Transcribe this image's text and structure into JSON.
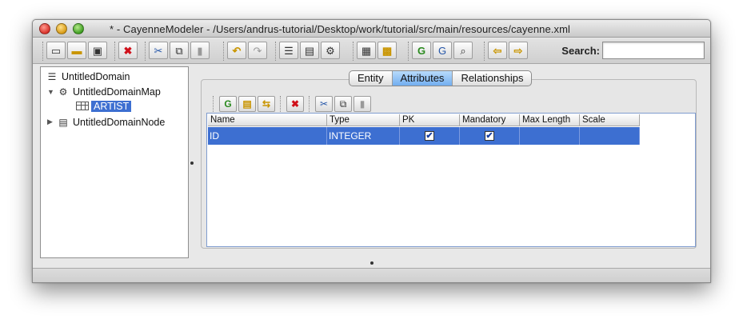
{
  "window": {
    "title": "* - CayenneModeler - /Users/andrus-tutorial/Desktop/work/tutorial/src/main/resources/cayenne.xml"
  },
  "toolbar": {
    "groups": [
      [
        {
          "name": "new-project-icon",
          "glyph": "▭"
        },
        {
          "name": "open-project-icon",
          "glyph": "📂"
        },
        {
          "name": "save-icon",
          "glyph": "▣"
        }
      ],
      [
        {
          "name": "remove-icon",
          "glyph": "✖"
        }
      ],
      [
        {
          "name": "cut-icon",
          "glyph": "✂"
        },
        {
          "name": "copy-icon",
          "glyph": "⧉"
        },
        {
          "name": "paste-icon",
          "glyph": "▮"
        }
      ],
      [
        {
          "name": "undo-icon",
          "glyph": "↶"
        },
        {
          "name": "redo-icon",
          "glyph": "↷"
        }
      ],
      [
        {
          "name": "create-domain-icon",
          "glyph": "☰"
        },
        {
          "name": "create-node-icon",
          "glyph": "▤"
        },
        {
          "name": "create-datamap-icon",
          "glyph": "⚙"
        }
      ],
      [
        {
          "name": "create-entity-icon",
          "glyph": "▦"
        },
        {
          "name": "create-embeddable-icon",
          "glyph": "▩"
        }
      ],
      [
        {
          "name": "create-query-icon",
          "glyph": "G"
        },
        {
          "name": "create-procedure-icon",
          "glyph": "G"
        },
        {
          "name": "find-icon",
          "glyph": "⌕"
        }
      ],
      [
        {
          "name": "navigate-back-icon",
          "glyph": "⇦"
        },
        {
          "name": "navigate-forward-icon",
          "glyph": "⇨"
        }
      ]
    ]
  },
  "search": {
    "label": "Search:",
    "value": ""
  },
  "tree": {
    "domain": "UntitledDomain",
    "datamap": "UntitledDomainMap",
    "entity": "ARTIST",
    "node": "UntitledDomainNode"
  },
  "tabs": [
    "Entity",
    "Attributes",
    "Relationships"
  ],
  "active_tab": "Attributes",
  "attributes_table": {
    "headers": [
      "Name",
      "Type",
      "PK",
      "Mandatory",
      "Max Length",
      "Scale"
    ],
    "rows": [
      {
        "name": "ID",
        "type": "INTEGER",
        "pk": true,
        "mandatory": true,
        "max_length": "",
        "scale": ""
      }
    ]
  },
  "colors": {
    "selection": "#3d6fd1",
    "active_tab": "#72aef0"
  }
}
